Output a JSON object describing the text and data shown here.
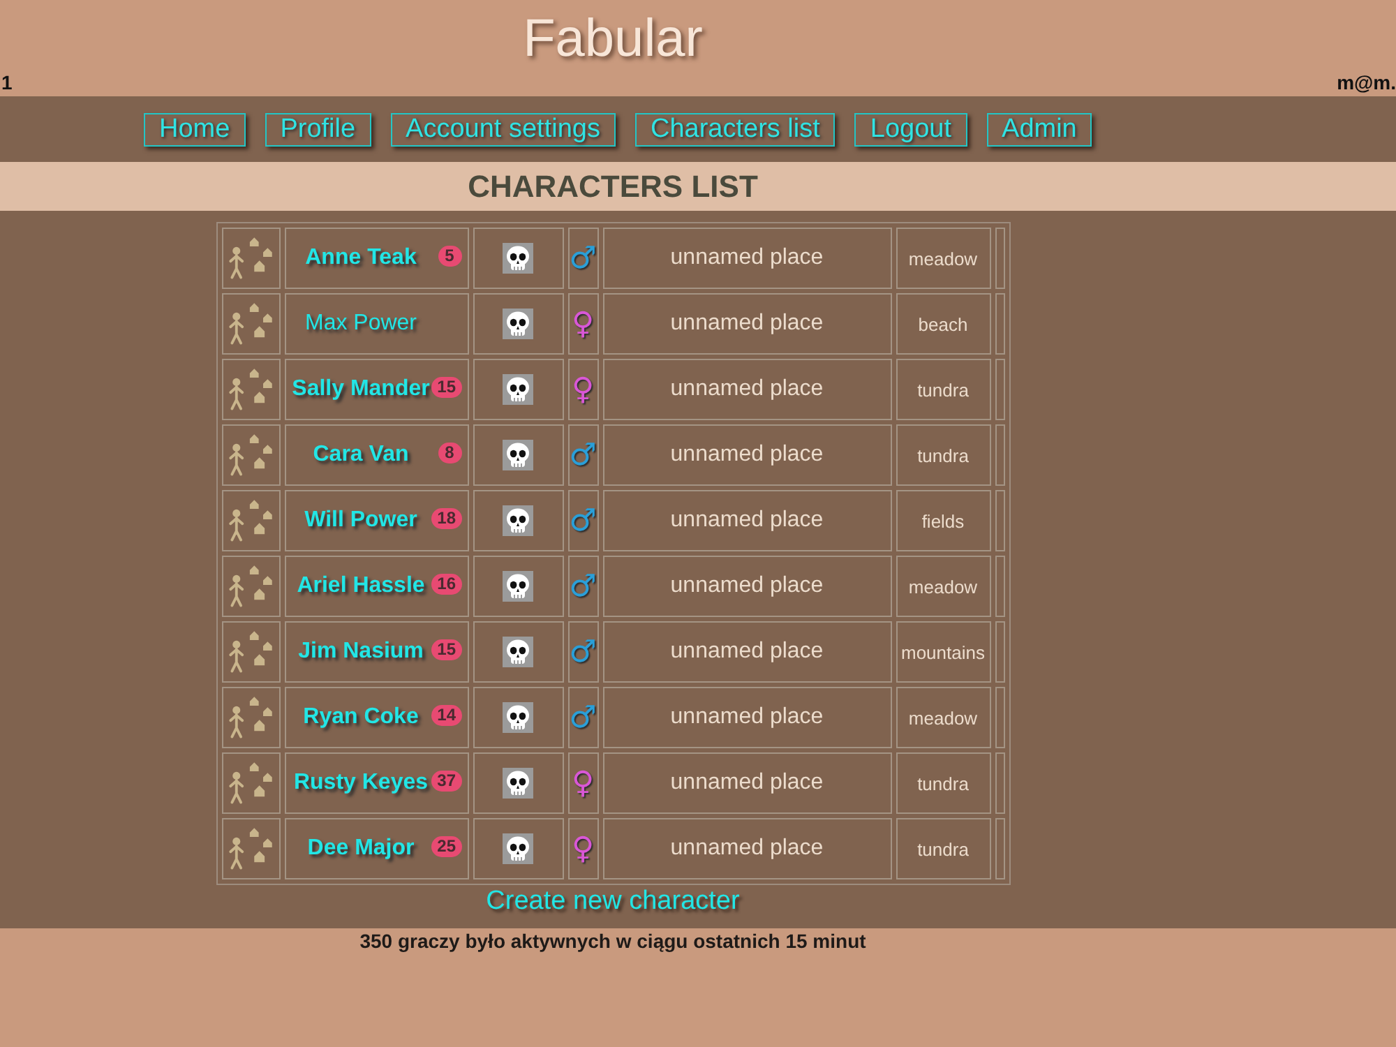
{
  "header": {
    "title": "Fabular",
    "left_text": "1",
    "user_email": "m@m."
  },
  "nav": [
    {
      "label": "Home"
    },
    {
      "label": "Profile"
    },
    {
      "label": "Account settings"
    },
    {
      "label": "Characters list"
    },
    {
      "label": "Logout"
    },
    {
      "label": "Admin"
    }
  ],
  "page_heading": "CHARACTERS LIST",
  "characters": [
    {
      "name": "Anne Teak",
      "active": true,
      "badge": "5",
      "sex_symbol": "♂",
      "color": "#2a9fd8",
      "place": "unnamed place",
      "terrain": "meadow"
    },
    {
      "name": "Max Power",
      "active": false,
      "sex_symbol": "♀",
      "color": "#d957d6",
      "place": "unnamed place",
      "terrain": "beach"
    },
    {
      "name": "Sally Mander",
      "active": true,
      "badge": "15",
      "sex_symbol": "♀",
      "color": "#d957d6",
      "place": "unnamed place",
      "terrain": "tundra"
    },
    {
      "name": "Cara Van",
      "active": true,
      "badge": "8",
      "sex_symbol": "♂",
      "color": "#2a9fd8",
      "place": "unnamed place",
      "terrain": "tundra"
    },
    {
      "name": "Will Power",
      "active": true,
      "badge": "18",
      "sex_symbol": "♂",
      "color": "#2a9fd8",
      "place": "unnamed place",
      "terrain": "fields"
    },
    {
      "name": "Ariel Hassle",
      "active": true,
      "badge": "16",
      "sex_symbol": "♂",
      "color": "#2a9fd8",
      "place": "unnamed place",
      "terrain": "meadow"
    },
    {
      "name": "Jim Nasium",
      "active": true,
      "badge": "15",
      "sex_symbol": "♂",
      "color": "#2a9fd8",
      "place": "unnamed place",
      "terrain": "mountains"
    },
    {
      "name": "Ryan Coke",
      "active": true,
      "badge": "14",
      "sex_symbol": "♂",
      "color": "#2a9fd8",
      "place": "unnamed place",
      "terrain": "meadow"
    },
    {
      "name": "Rusty Keyes",
      "active": true,
      "badge": "37",
      "sex_symbol": "♀",
      "color": "#d957d6",
      "place": "unnamed place",
      "terrain": "tundra"
    },
    {
      "name": "Dee Major",
      "active": true,
      "badge": "25",
      "sex_symbol": "♀",
      "color": "#d957d6",
      "place": "unnamed place",
      "terrain": "tundra"
    }
  ],
  "create_link": "Create new character",
  "footer": "350 graczy było aktywnych w ciągu ostatnich 15 minut"
}
